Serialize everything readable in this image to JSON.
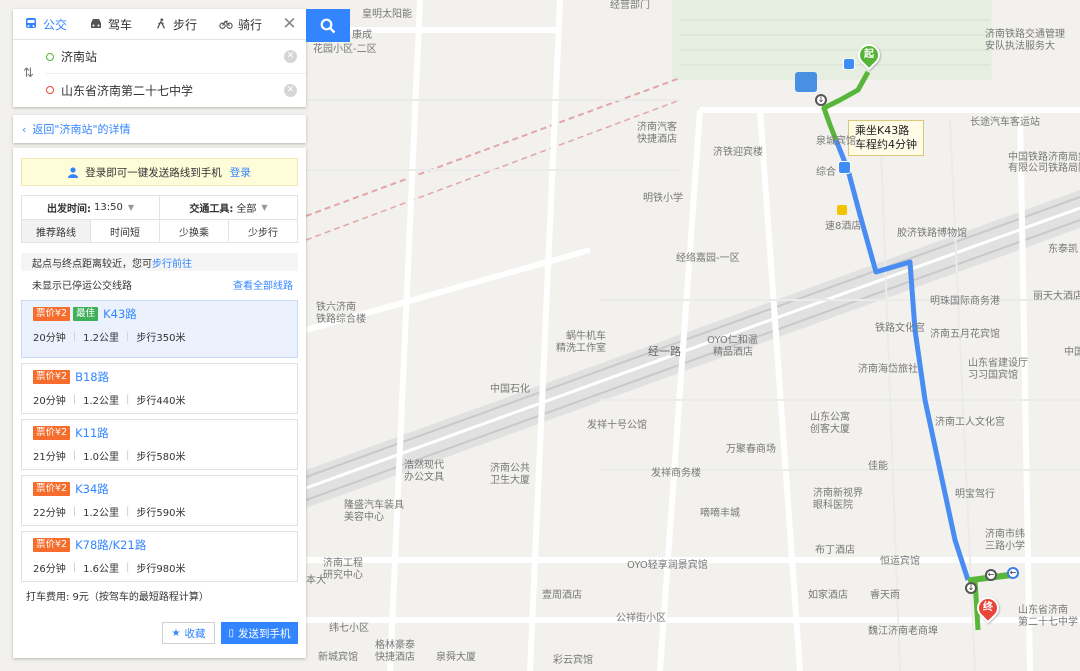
{
  "modes": [
    {
      "label": "公交",
      "icon": "bus-icon"
    },
    {
      "label": "驾车",
      "icon": "car-icon"
    },
    {
      "label": "步行",
      "icon": "walk-icon"
    },
    {
      "label": "骑行",
      "icon": "bike-icon"
    }
  ],
  "active_mode": "公交",
  "origin": "济南站",
  "destination": "山东省济南第二十七中学",
  "back_link": "返回\"济南站\"的详情",
  "login_prompt": "登录即可一键发送路线到手机",
  "login_link": "登录",
  "filters": {
    "depart_label": "出发时间:",
    "depart_value": "13:50",
    "tool_label": "交通工具:",
    "tool_value": "全部"
  },
  "sort_tabs": [
    "推荐路线",
    "时间短",
    "少换乘",
    "少步行"
  ],
  "active_sort": "推荐路线",
  "notice": {
    "text": "起点与终点距离较近，您可",
    "link": "步行前往"
  },
  "notice2": {
    "text": "未显示已停运公交线路",
    "link": "查看全部线路"
  },
  "routes": [
    {
      "price": "票价¥2",
      "best": "最佳",
      "name": "K43路",
      "duration": "20分钟",
      "distance": "1.2公里",
      "walk": "步行350米"
    },
    {
      "price": "票价¥2",
      "best": "",
      "name": "B18路",
      "duration": "20分钟",
      "distance": "1.2公里",
      "walk": "步行440米"
    },
    {
      "price": "票价¥2",
      "best": "",
      "name": "K11路",
      "duration": "21分钟",
      "distance": "1.0公里",
      "walk": "步行580米"
    },
    {
      "price": "票价¥2",
      "best": "",
      "name": "K34路",
      "duration": "22分钟",
      "distance": "1.2公里",
      "walk": "步行590米"
    },
    {
      "price": "票价¥2",
      "best": "",
      "name": "K78路/K21路",
      "duration": "26分钟",
      "distance": "1.6公里",
      "walk": "步行980米"
    }
  ],
  "taxi": "打车费用: 9元（按驾车的最短路程计算）",
  "buttons": {
    "favorite": "收藏",
    "send": "发送到手机"
  },
  "map": {
    "bubble_line1": "乘坐K43路",
    "bubble_line2": "车程约4分钟",
    "start_pin": "起",
    "end_pin": "终",
    "labels": [
      {
        "t": "经营部门"
      },
      {
        "t": "皇明太阳能"
      },
      {
        "t": "济南铁路交通管理"
      },
      {
        "t": "安队执法服务大"
      },
      {
        "t": "花园小区-二区"
      },
      {
        "t": "康成"
      },
      {
        "t": "济南汽客"
      },
      {
        "t": "快捷酒店"
      },
      {
        "t": "济铁迎宾楼"
      },
      {
        "t": "泉城宾馆"
      },
      {
        "t": "综合"
      },
      {
        "t": "长途汽车客运站"
      },
      {
        "t": "中国铁路济南局集"
      },
      {
        "t": "有限公司铁路局附属"
      },
      {
        "t": "明铁小学"
      },
      {
        "t": "速8酒店"
      },
      {
        "t": "胶济铁路博物馆"
      },
      {
        "t": "东泰凯"
      },
      {
        "t": "经络嘉园-一区"
      },
      {
        "t": "丽天大酒店"
      },
      {
        "t": "明珠国际商务港"
      },
      {
        "t": "铁路文化宫"
      },
      {
        "t": "济南五月花宾馆"
      },
      {
        "t": "山东省建设厅"
      },
      {
        "t": "习习国宾馆"
      },
      {
        "t": "济南海岱旅社"
      },
      {
        "t": "中国"
      },
      {
        "t": "铁六济南"
      },
      {
        "t": "铁路综合楼"
      },
      {
        "t": "蜗牛机车"
      },
      {
        "t": "精洗工作室"
      },
      {
        "t": "OYO仁和温"
      },
      {
        "t": "精品酒店"
      },
      {
        "t": "经一路"
      },
      {
        "t": "中国石化"
      },
      {
        "t": "山东公寓"
      },
      {
        "t": "创客大厦"
      },
      {
        "t": "济南工人文化宫"
      },
      {
        "t": "发祥十号公馆"
      },
      {
        "t": "万聚春商场"
      },
      {
        "t": "佳能"
      },
      {
        "t": "济南公共"
      },
      {
        "t": "卫生大厦"
      },
      {
        "t": "浩然现代"
      },
      {
        "t": "办公文具"
      },
      {
        "t": "发祥商务楼"
      },
      {
        "t": "济南新视界"
      },
      {
        "t": "眼科医院"
      },
      {
        "t": "明宝驾行"
      },
      {
        "t": "隆盛汽车装具"
      },
      {
        "t": "美容中心"
      },
      {
        "t": "嘀嘀丰城"
      },
      {
        "t": "济南市纬"
      },
      {
        "t": "三路小学"
      },
      {
        "t": "布丁酒店"
      },
      {
        "t": "恒运宾馆"
      },
      {
        "t": "济南工程"
      },
      {
        "t": "研究中心"
      },
      {
        "t": "OYO轻享润景宾馆"
      },
      {
        "t": "壹周酒店"
      },
      {
        "t": "如家酒店"
      },
      {
        "t": "睿天雨"
      },
      {
        "t": "公祥街小区"
      },
      {
        "t": "山东省济南"
      },
      {
        "t": "第二十七中学"
      },
      {
        "t": "纬七小区"
      },
      {
        "t": "格林豪泰"
      },
      {
        "t": "快捷酒店"
      },
      {
        "t": "魏江济南老商埠"
      },
      {
        "t": "新城宾馆"
      },
      {
        "t": "泉舜大厦"
      },
      {
        "t": "彩云宾馆"
      },
      {
        "t": "本大"
      }
    ]
  }
}
